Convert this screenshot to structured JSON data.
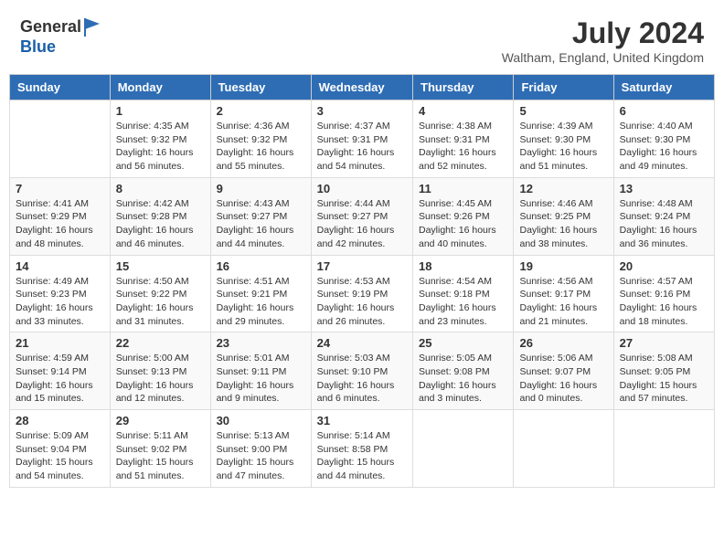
{
  "logo": {
    "general": "General",
    "blue": "Blue"
  },
  "title": {
    "month_year": "July 2024",
    "location": "Waltham, England, United Kingdom"
  },
  "days_of_week": [
    "Sunday",
    "Monday",
    "Tuesday",
    "Wednesday",
    "Thursday",
    "Friday",
    "Saturday"
  ],
  "weeks": [
    [
      {
        "day": "",
        "info": ""
      },
      {
        "day": "1",
        "info": "Sunrise: 4:35 AM\nSunset: 9:32 PM\nDaylight: 16 hours and 56 minutes."
      },
      {
        "day": "2",
        "info": "Sunrise: 4:36 AM\nSunset: 9:32 PM\nDaylight: 16 hours and 55 minutes."
      },
      {
        "day": "3",
        "info": "Sunrise: 4:37 AM\nSunset: 9:31 PM\nDaylight: 16 hours and 54 minutes."
      },
      {
        "day": "4",
        "info": "Sunrise: 4:38 AM\nSunset: 9:31 PM\nDaylight: 16 hours and 52 minutes."
      },
      {
        "day": "5",
        "info": "Sunrise: 4:39 AM\nSunset: 9:30 PM\nDaylight: 16 hours and 51 minutes."
      },
      {
        "day": "6",
        "info": "Sunrise: 4:40 AM\nSunset: 9:30 PM\nDaylight: 16 hours and 49 minutes."
      }
    ],
    [
      {
        "day": "7",
        "info": "Sunrise: 4:41 AM\nSunset: 9:29 PM\nDaylight: 16 hours and 48 minutes."
      },
      {
        "day": "8",
        "info": "Sunrise: 4:42 AM\nSunset: 9:28 PM\nDaylight: 16 hours and 46 minutes."
      },
      {
        "day": "9",
        "info": "Sunrise: 4:43 AM\nSunset: 9:27 PM\nDaylight: 16 hours and 44 minutes."
      },
      {
        "day": "10",
        "info": "Sunrise: 4:44 AM\nSunset: 9:27 PM\nDaylight: 16 hours and 42 minutes."
      },
      {
        "day": "11",
        "info": "Sunrise: 4:45 AM\nSunset: 9:26 PM\nDaylight: 16 hours and 40 minutes."
      },
      {
        "day": "12",
        "info": "Sunrise: 4:46 AM\nSunset: 9:25 PM\nDaylight: 16 hours and 38 minutes."
      },
      {
        "day": "13",
        "info": "Sunrise: 4:48 AM\nSunset: 9:24 PM\nDaylight: 16 hours and 36 minutes."
      }
    ],
    [
      {
        "day": "14",
        "info": "Sunrise: 4:49 AM\nSunset: 9:23 PM\nDaylight: 16 hours and 33 minutes."
      },
      {
        "day": "15",
        "info": "Sunrise: 4:50 AM\nSunset: 9:22 PM\nDaylight: 16 hours and 31 minutes."
      },
      {
        "day": "16",
        "info": "Sunrise: 4:51 AM\nSunset: 9:21 PM\nDaylight: 16 hours and 29 minutes."
      },
      {
        "day": "17",
        "info": "Sunrise: 4:53 AM\nSunset: 9:19 PM\nDaylight: 16 hours and 26 minutes."
      },
      {
        "day": "18",
        "info": "Sunrise: 4:54 AM\nSunset: 9:18 PM\nDaylight: 16 hours and 23 minutes."
      },
      {
        "day": "19",
        "info": "Sunrise: 4:56 AM\nSunset: 9:17 PM\nDaylight: 16 hours and 21 minutes."
      },
      {
        "day": "20",
        "info": "Sunrise: 4:57 AM\nSunset: 9:16 PM\nDaylight: 16 hours and 18 minutes."
      }
    ],
    [
      {
        "day": "21",
        "info": "Sunrise: 4:59 AM\nSunset: 9:14 PM\nDaylight: 16 hours and 15 minutes."
      },
      {
        "day": "22",
        "info": "Sunrise: 5:00 AM\nSunset: 9:13 PM\nDaylight: 16 hours and 12 minutes."
      },
      {
        "day": "23",
        "info": "Sunrise: 5:01 AM\nSunset: 9:11 PM\nDaylight: 16 hours and 9 minutes."
      },
      {
        "day": "24",
        "info": "Sunrise: 5:03 AM\nSunset: 9:10 PM\nDaylight: 16 hours and 6 minutes."
      },
      {
        "day": "25",
        "info": "Sunrise: 5:05 AM\nSunset: 9:08 PM\nDaylight: 16 hours and 3 minutes."
      },
      {
        "day": "26",
        "info": "Sunrise: 5:06 AM\nSunset: 9:07 PM\nDaylight: 16 hours and 0 minutes."
      },
      {
        "day": "27",
        "info": "Sunrise: 5:08 AM\nSunset: 9:05 PM\nDaylight: 15 hours and 57 minutes."
      }
    ],
    [
      {
        "day": "28",
        "info": "Sunrise: 5:09 AM\nSunset: 9:04 PM\nDaylight: 15 hours and 54 minutes."
      },
      {
        "day": "29",
        "info": "Sunrise: 5:11 AM\nSunset: 9:02 PM\nDaylight: 15 hours and 51 minutes."
      },
      {
        "day": "30",
        "info": "Sunrise: 5:13 AM\nSunset: 9:00 PM\nDaylight: 15 hours and 47 minutes."
      },
      {
        "day": "31",
        "info": "Sunrise: 5:14 AM\nSunset: 8:58 PM\nDaylight: 15 hours and 44 minutes."
      },
      {
        "day": "",
        "info": ""
      },
      {
        "day": "",
        "info": ""
      },
      {
        "day": "",
        "info": ""
      }
    ]
  ]
}
